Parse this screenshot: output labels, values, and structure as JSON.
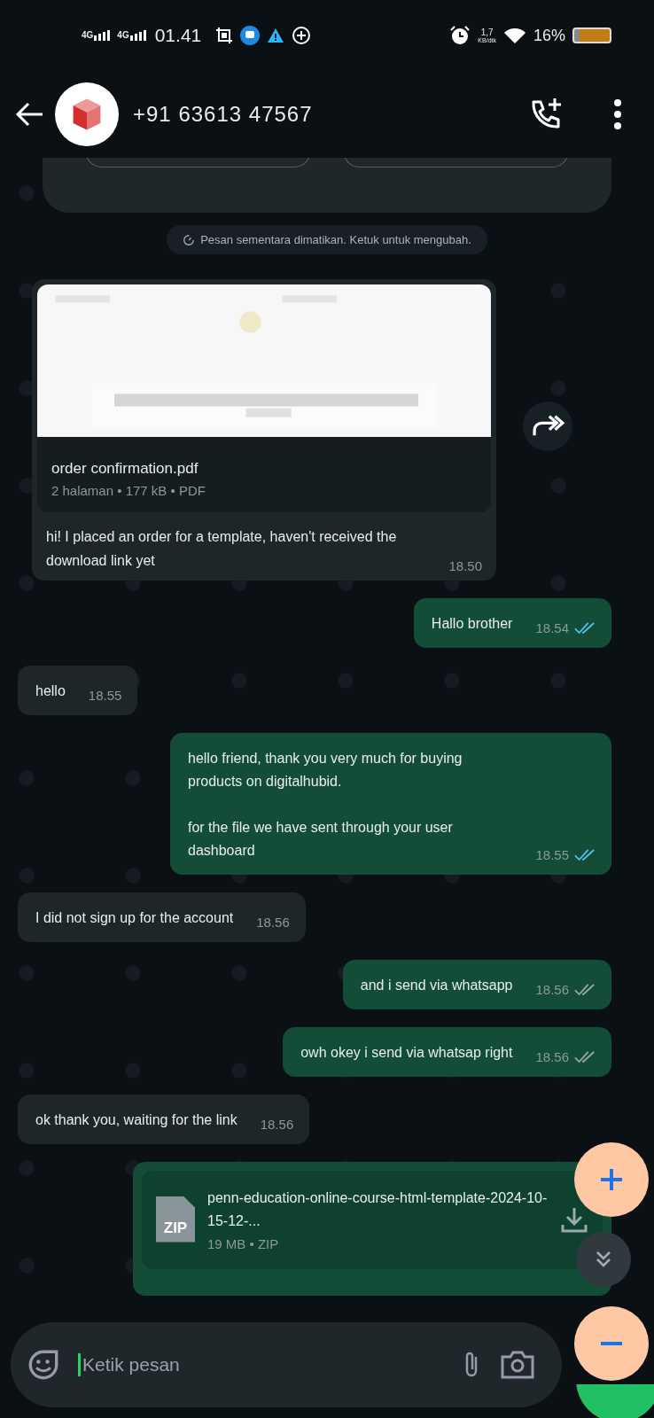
{
  "status_bar": {
    "signal_1": "4G",
    "signal_2": "4G",
    "time": "01.41",
    "speed": "1,7",
    "speed_unit": "KB/dtk",
    "battery": "16%"
  },
  "header": {
    "contact": "+91 63613 47567"
  },
  "notice": "Pesan sementara dimatikan. Ketuk untuk mengubah.",
  "messages": [
    {
      "kind": "document_in",
      "file_name": "order confirmation.pdf",
      "file_meta": "2 halaman • 177 kB • PDF",
      "text": "hi! I placed an order for a template, haven't received the download link yet",
      "time": "18.50"
    },
    {
      "kind": "outgoing",
      "text": "Hallo brother",
      "time": "18.54",
      "read": true
    },
    {
      "kind": "incoming",
      "text": "hello",
      "time": "18.55"
    },
    {
      "kind": "outgoing",
      "text": "hello friend, thank you very much for buying products on digitalhubid.\n\nfor the file we have sent through your user dashboard",
      "time": "18.55",
      "read": true
    },
    {
      "kind": "incoming",
      "text": "I did not sign up for the account",
      "time": "18.56"
    },
    {
      "kind": "outgoing",
      "text": "and i send via whatsapp",
      "time": "18.56",
      "read": false
    },
    {
      "kind": "outgoing",
      "text": "owh okey i send via whatsap right",
      "time": "18.56",
      "read": false
    },
    {
      "kind": "incoming",
      "text": "ok thank you, waiting for the link",
      "time": "18.56"
    },
    {
      "kind": "document_out",
      "file_type": "ZIP",
      "file_name": "penn-education-online-course-html-template-2024-10-15-12-...",
      "file_meta": "19 MB • ZIP"
    }
  ],
  "composer": {
    "placeholder": "Ketik pesan"
  }
}
